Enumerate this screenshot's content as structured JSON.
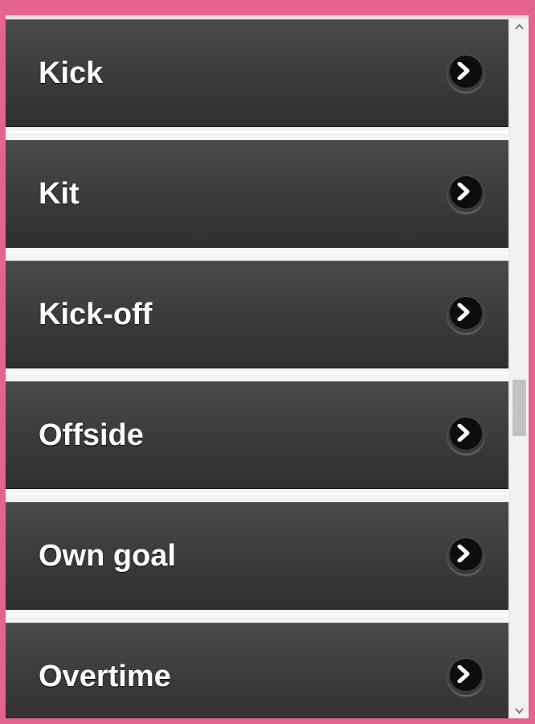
{
  "list": {
    "items": [
      {
        "label": "Kick"
      },
      {
        "label": "Kit"
      },
      {
        "label": "Kick-off"
      },
      {
        "label": "Offside"
      },
      {
        "label": "Own goal"
      },
      {
        "label": "Overtime"
      }
    ],
    "arrow_icon": "chevron-right-icon"
  },
  "scrollbar": {
    "up_icon": "scroll-up-arrow-icon",
    "down_icon": "scroll-down-arrow-icon"
  },
  "colors": {
    "frame_border": "#e56391",
    "item_background": "#3d3d3d",
    "item_text": "#ffffff",
    "arrow_button": "#0d0d0d"
  }
}
